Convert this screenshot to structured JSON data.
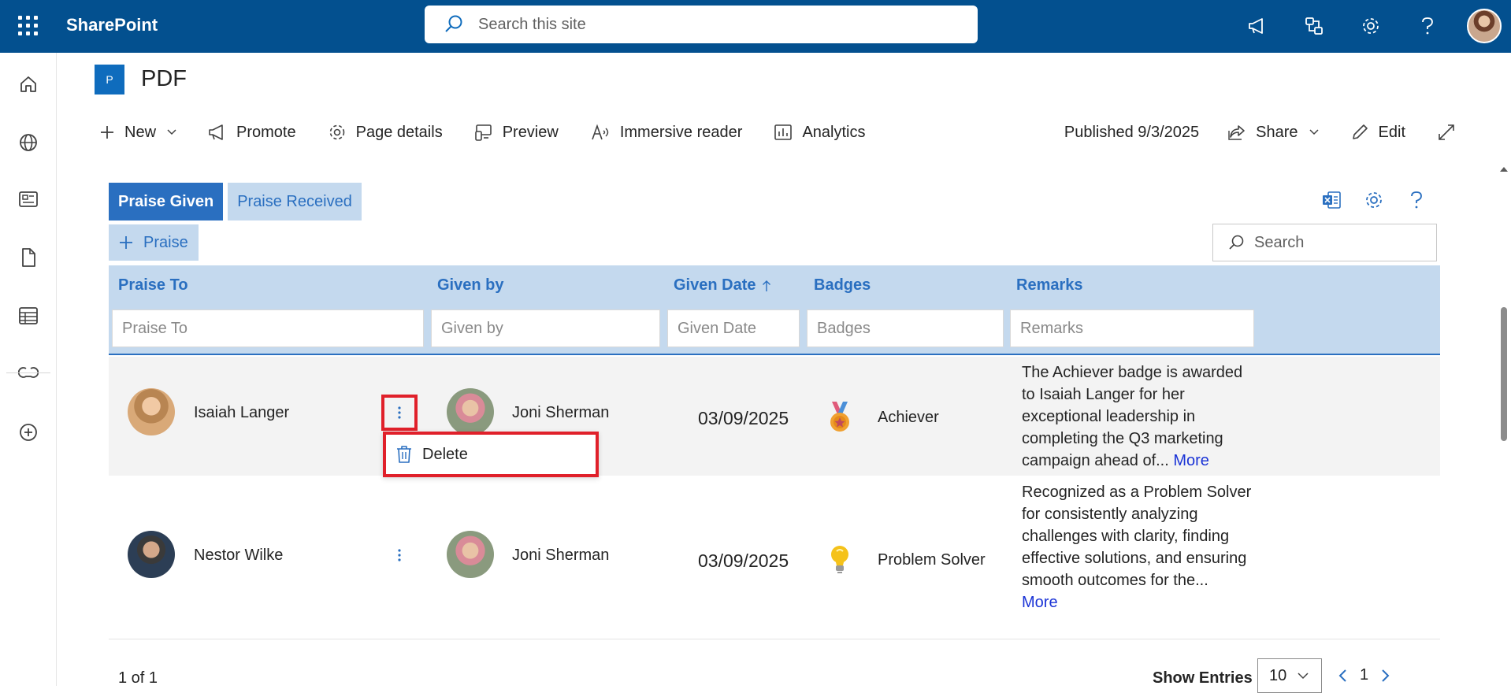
{
  "suite": {
    "brand": "SharePoint",
    "search_placeholder": "Search this site"
  },
  "page": {
    "site_logo_letter": "P",
    "title": "PDF"
  },
  "commands": {
    "new": "New",
    "promote": "Promote",
    "page_details": "Page details",
    "preview": "Preview",
    "immersive_reader": "Immersive reader",
    "analytics": "Analytics",
    "published": "Published 9/3/2025",
    "share": "Share",
    "edit": "Edit"
  },
  "webpart": {
    "tabs": [
      "Praise Given",
      "Praise Received"
    ],
    "praise_button": "Praise",
    "search_placeholder": "Search",
    "columns": [
      "Praise To",
      "Given by",
      "Given Date",
      "Badges",
      "Remarks"
    ],
    "filters": [
      "Praise To",
      "Given by",
      "Given Date",
      "Badges",
      "Remarks"
    ],
    "rows": [
      {
        "praise_to": "Isaiah Langer",
        "given_by": "Joni Sherman",
        "date": "03/09/2025",
        "badge": "Achiever",
        "badge_icon": "medal-icon",
        "remarks": "The Achiever badge is awarded to Isaiah Langer for her exceptional leadership in completing the Q3 marketing campaign ahead of...",
        "more": " More"
      },
      {
        "praise_to": "Nestor Wilke",
        "given_by": "Joni Sherman",
        "date": "03/09/2025",
        "badge": "Problem Solver",
        "badge_icon": "lightbulb-icon",
        "remarks": "Recognized as a Problem Solver for consistently analyzing challenges with clarity, finding effective solutions, and ensuring smooth outcomes for the...",
        "more": "More"
      }
    ],
    "context_menu": {
      "delete": "Delete"
    },
    "footer": {
      "count": "1 of 1",
      "show_entries": "Show Entries",
      "entries_value": "10",
      "page": "1"
    }
  },
  "colors": {
    "suitebar": "#03508f",
    "accent": "#2a6fc0",
    "header_bg": "#c4d9ee",
    "highlight": "#e0202a"
  }
}
